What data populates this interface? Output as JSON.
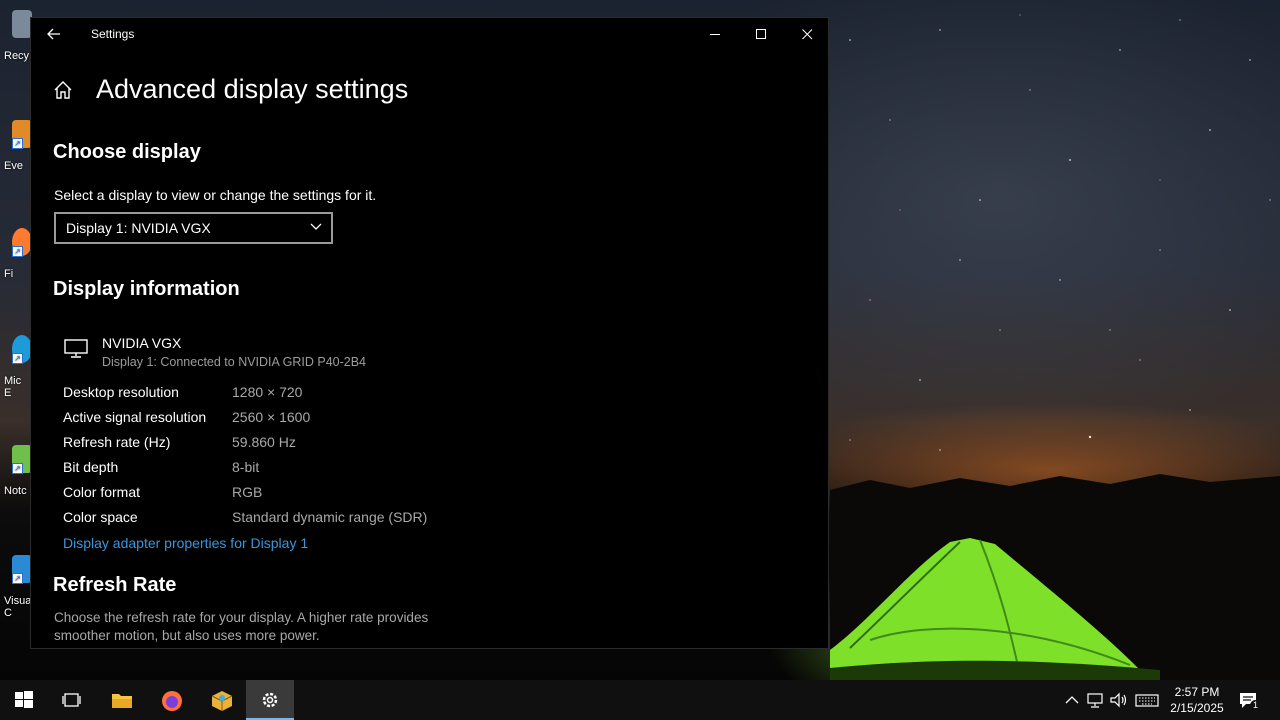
{
  "desktop": {
    "icons": [
      {
        "name": "recycle-bin",
        "label": "Recy"
      },
      {
        "name": "everything",
        "label": "Eve"
      },
      {
        "name": "firefox",
        "label": "Fi"
      },
      {
        "name": "microsoft-edge",
        "label": "Mic\nE"
      },
      {
        "name": "notepad",
        "label": "Notc"
      },
      {
        "name": "visual-studio-code",
        "label": "Visua\nC"
      }
    ]
  },
  "window": {
    "title": "Settings",
    "page_title": "Advanced display settings",
    "choose_display": {
      "heading": "Choose display",
      "instruction": "Select a display to view or change the settings for it.",
      "selected_display": "Display 1: NVIDIA VGX"
    },
    "display_information": {
      "heading": "Display information",
      "monitor_name": "NVIDIA VGX",
      "monitor_connection": "Display 1: Connected to NVIDIA GRID P40-2B4",
      "rows": [
        {
          "label": "Desktop resolution",
          "value": "1280 × 720"
        },
        {
          "label": "Active signal resolution",
          "value": "2560 × 1600"
        },
        {
          "label": "Refresh rate (Hz)",
          "value": "59.860 Hz"
        },
        {
          "label": "Bit depth",
          "value": "8-bit"
        },
        {
          "label": "Color format",
          "value": "RGB"
        },
        {
          "label": "Color space",
          "value": "Standard dynamic range (SDR)"
        }
      ],
      "adapter_link": "Display adapter properties for Display 1"
    },
    "refresh_rate": {
      "heading": "Refresh Rate",
      "description": "Choose the refresh rate for your display. A higher rate provides smoother motion, but also uses more power."
    }
  },
  "taskbar": {
    "items": [
      "start-icon",
      "task-view-icon",
      "file-explorer-icon",
      "firefox-icon",
      "package-icon",
      "settings-icon"
    ],
    "time": "2:57 PM",
    "date": "2/15/2025",
    "notification_count": "1"
  },
  "colors": {
    "accent_link": "#3a96dd",
    "window_bg": "#000000",
    "taskbar_bg": "#101010"
  }
}
